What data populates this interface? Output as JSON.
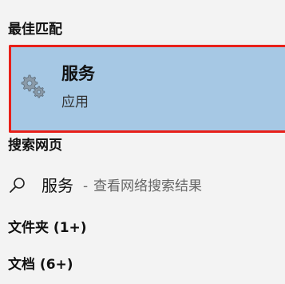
{
  "sections": {
    "best_match": "最佳匹配",
    "web": "搜索网页",
    "folders": "文件夹 (1+)",
    "documents": "文档 (6+)"
  },
  "best_match_item": {
    "title": "服务",
    "subtitle": "应用",
    "icon": "services-gears-icon"
  },
  "web_result": {
    "query": "服务",
    "separator": "-",
    "hint": "查看网络搜索结果",
    "icon": "search-icon"
  },
  "colors": {
    "background": "#f3f3f3",
    "selection": "#a6c8e4",
    "highlight_border": "#e8201a"
  }
}
